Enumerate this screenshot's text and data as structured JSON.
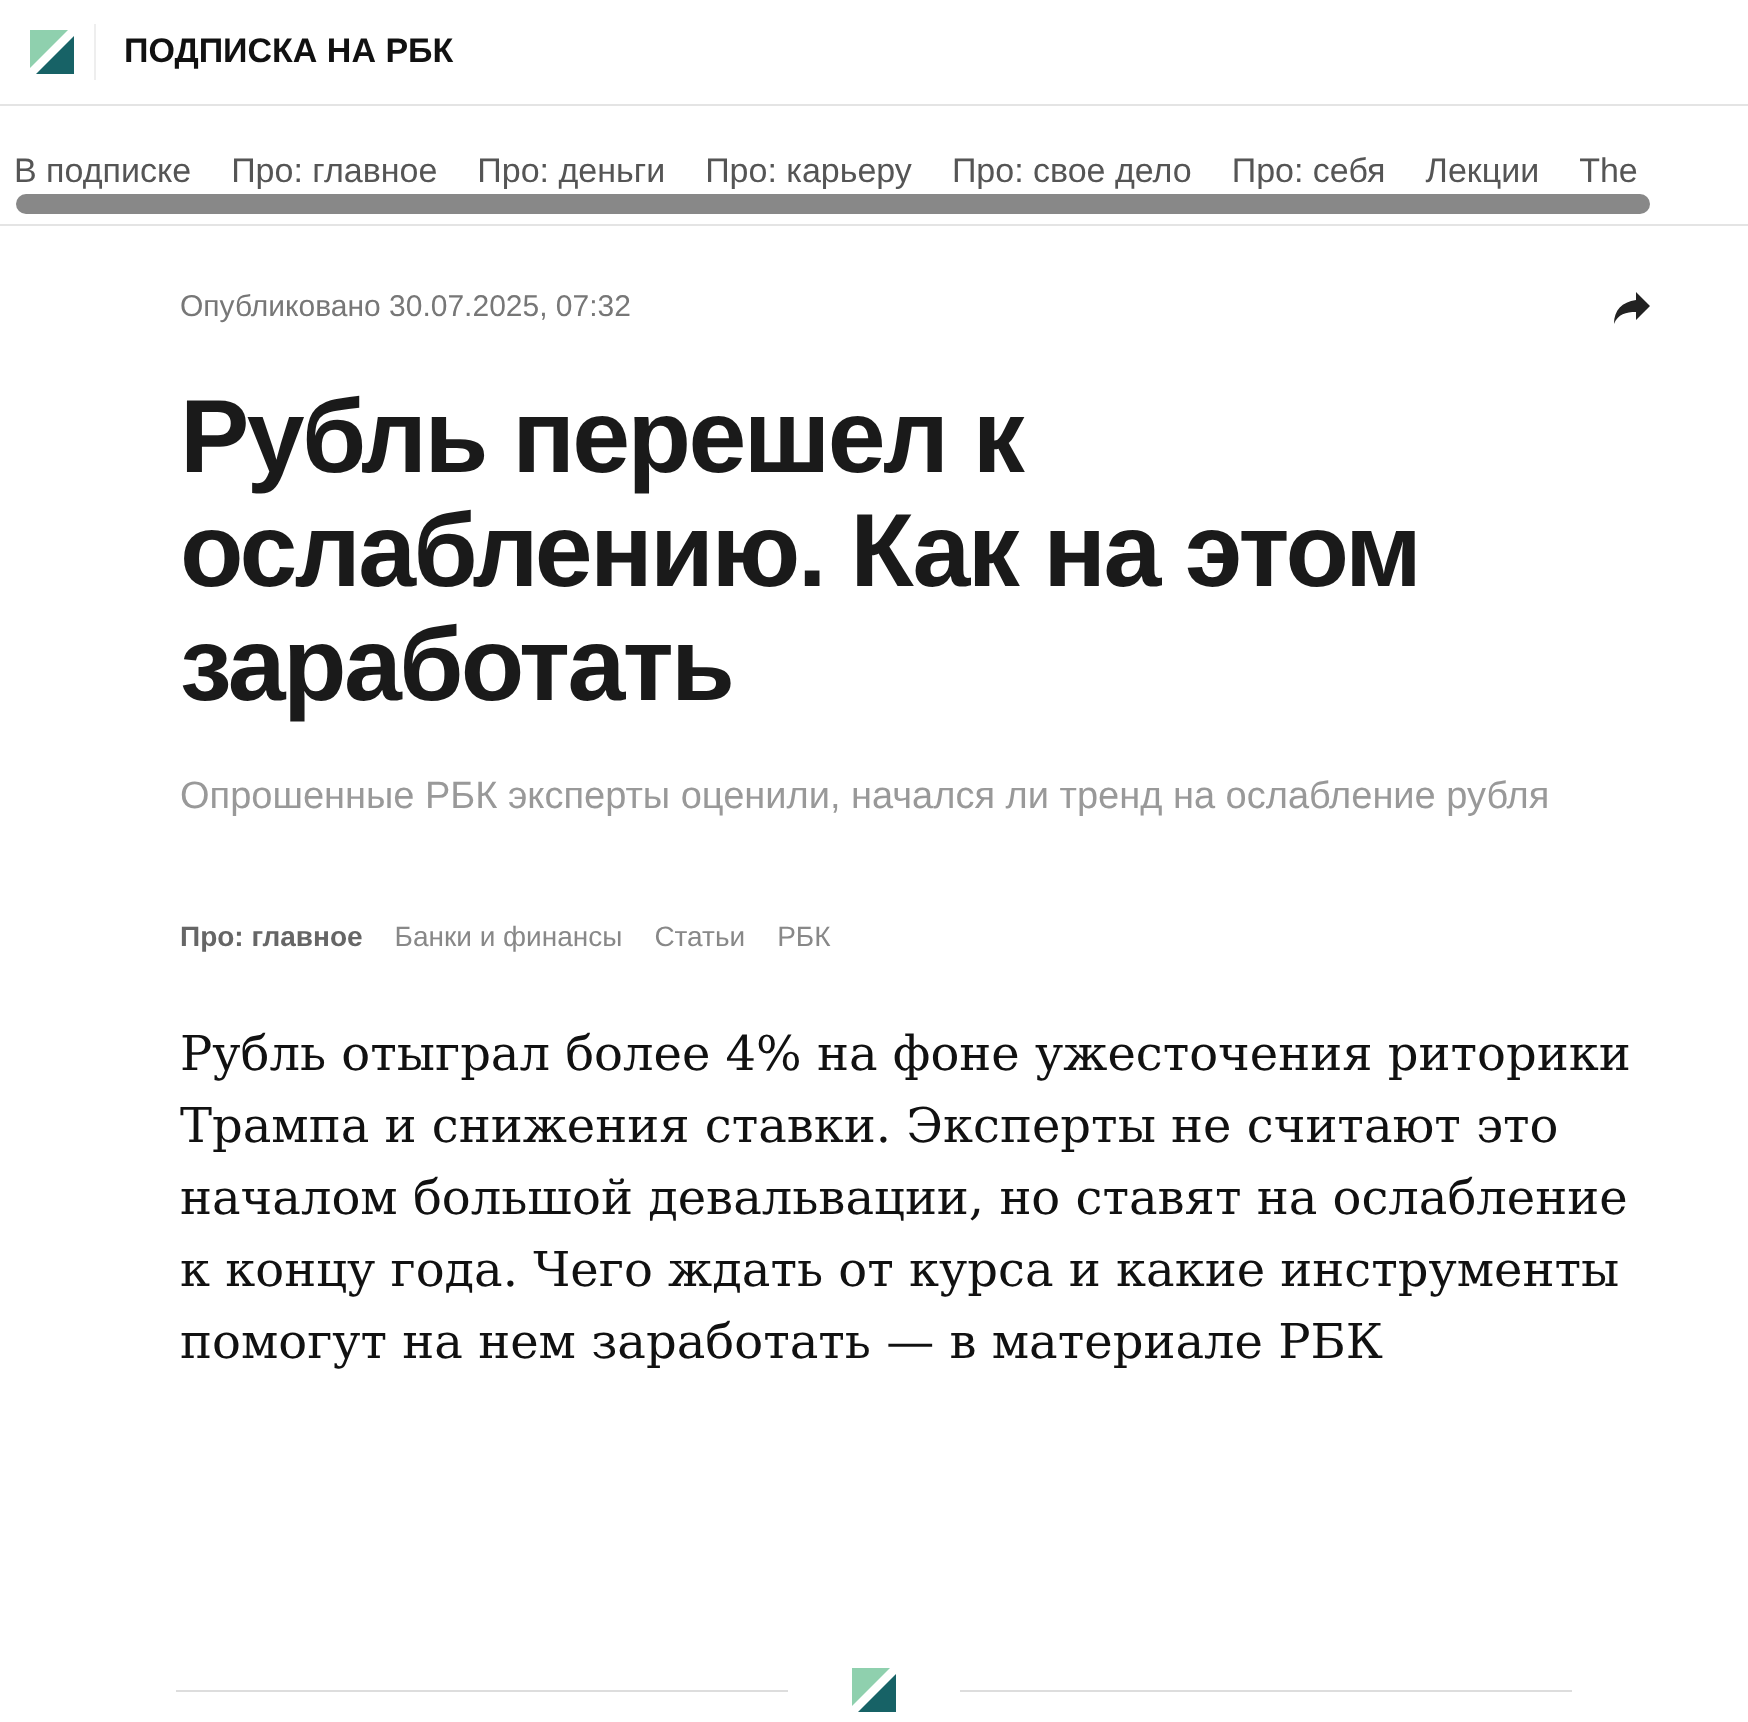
{
  "header": {
    "title": "ПОДПИСКА НА РБК"
  },
  "nav": [
    "В подписке",
    "Про: главное",
    "Про: деньги",
    "Про: карьеру",
    "Про: свое дело",
    "Про: себя",
    "Лекции",
    "The"
  ],
  "article": {
    "published": "Опубликовано 30.07.2025, 07:32",
    "title": "Рубль перешел к ослаблению. Как на этом заработать",
    "subtitle": "Опрошенные РБК эксперты оценили, начался ли тренд на ослабление рубля",
    "tags": [
      {
        "label": "Про: главное",
        "kind": "rubric"
      },
      {
        "label": "Банки и финансы",
        "kind": "tag"
      },
      {
        "label": "Статьи",
        "kind": "tag"
      },
      {
        "label": "РБК",
        "kind": "tag"
      }
    ],
    "lead": "Рубль отыграл более 4% на фоне ужесточения риторики Трампа и снижения ставки. Эксперты не считают это началом большой девальвации, но ставят на ослабление к концу года. Чего ждать от курса и какие инструменты помогут на нем заработать — в материале РБК"
  }
}
